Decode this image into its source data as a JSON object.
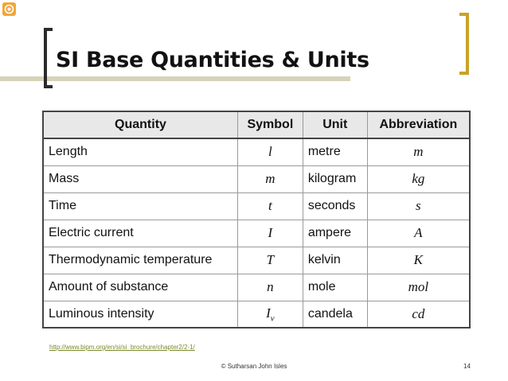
{
  "slide": {
    "title": "SI Base Quantities & Units",
    "source_url": "http://www.bipm.org/en/si/si_brochure/chapter2/2-1/",
    "author": "© Sutharsan John Isles",
    "page_number": "14",
    "colors": {
      "right_bracket": "#c9a227",
      "title_band": "#d6d3ba",
      "corner_icon": "#f3a53a",
      "link": "#7b8a2a"
    }
  },
  "table": {
    "headers": [
      "Quantity",
      "Symbol",
      "Unit",
      "Abbreviation"
    ],
    "rows": [
      {
        "quantity": "Length",
        "symbol": "l",
        "symbol_sub": "",
        "unit": "metre",
        "abbreviation": "m"
      },
      {
        "quantity": "Mass",
        "symbol": "m",
        "symbol_sub": "",
        "unit": "kilogram",
        "abbreviation": "kg"
      },
      {
        "quantity": "Time",
        "symbol": "t",
        "symbol_sub": "",
        "unit": "seconds",
        "abbreviation": "s"
      },
      {
        "quantity": "Electric current",
        "symbol": "I",
        "symbol_sub": "",
        "unit": "ampere",
        "abbreviation": "A"
      },
      {
        "quantity": "Thermodynamic temperature",
        "symbol": "T",
        "symbol_sub": "",
        "unit": "kelvin",
        "abbreviation": "K"
      },
      {
        "quantity": "Amount of substance",
        "symbol": "n",
        "symbol_sub": "",
        "unit": "mole",
        "abbreviation": "mol"
      },
      {
        "quantity": "Luminous intensity",
        "symbol": "I",
        "symbol_sub": "v",
        "unit": "candela",
        "abbreviation": "cd"
      }
    ]
  }
}
